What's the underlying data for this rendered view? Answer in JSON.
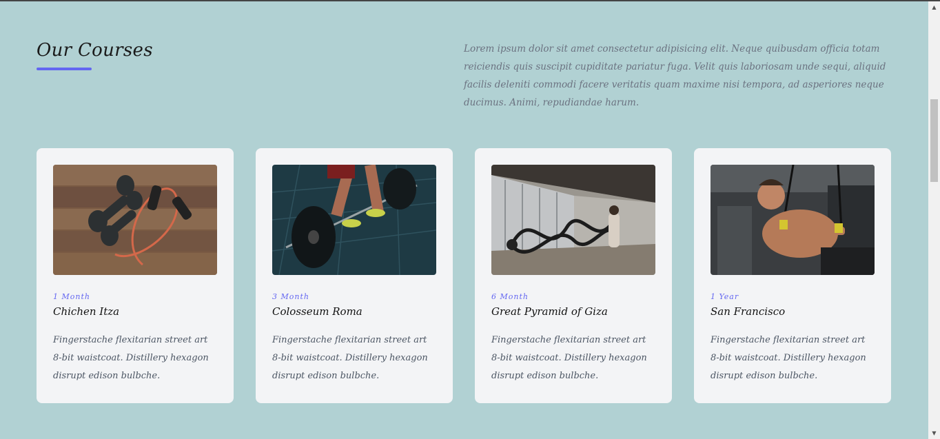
{
  "section": {
    "title": "Our Courses",
    "intro": "Lorem ipsum dolor sit amet consectetur adipisicing elit. Neque quibusdam officia totam reiciendis quis suscipit cupiditate pariatur fuga. Velit quis laboriosam unde sequi, aliquid facilis deleniti commodi facere veritatis quam maxime nisi tempora, ad asperiores neque ducimus. Animi, repudiandae harum."
  },
  "courses": [
    {
      "duration": "1 Month",
      "title": "Chichen Itza",
      "description": "Fingerstache flexitarian street art 8-bit waistcoat. Distillery hexagon disrupt edison bulbche.",
      "image": "dumbbells-and-resistance-band"
    },
    {
      "duration": "3 Month",
      "title": "Colosseum Roma",
      "description": "Fingerstache flexitarian street art 8-bit waistcoat. Distillery hexagon disrupt edison bulbche.",
      "image": "barbell-deadlift"
    },
    {
      "duration": "6 Month",
      "title": "Great Pyramid of Giza",
      "description": "Fingerstache flexitarian street art 8-bit waistcoat. Distillery hexagon disrupt edison bulbche.",
      "image": "battle-ropes"
    },
    {
      "duration": "1 Year",
      "title": "San Francisco",
      "description": "Fingerstache flexitarian street art 8-bit waistcoat. Distillery hexagon disrupt edison bulbche.",
      "image": "trx-suspension-training"
    }
  ],
  "colors": {
    "background": "#b1d1d3",
    "accent": "#6366f1",
    "card": "#f3f4f6"
  }
}
